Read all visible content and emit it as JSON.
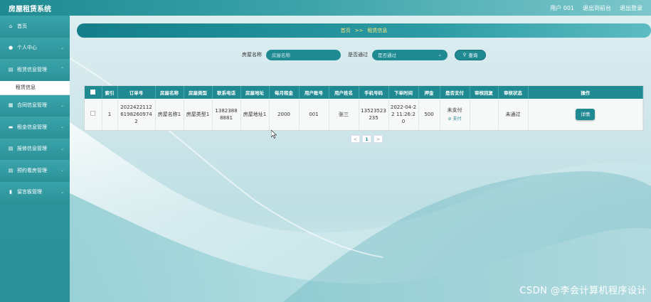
{
  "header": {
    "app_title": "房屋租赁系统",
    "user": "用户 001",
    "back_to_front": "退出到前台",
    "logout": "退出登录"
  },
  "sidebar": {
    "items": [
      {
        "label": "首页",
        "icon": "home-icon"
      },
      {
        "label": "个人中心",
        "icon": "user-icon"
      },
      {
        "label": "租赁信息管理",
        "icon": "doc-icon"
      },
      {
        "label": "合同信息管理",
        "icon": "grid-icon"
      },
      {
        "label": "租金信息管理",
        "icon": "card-icon"
      },
      {
        "label": "报修信息管理",
        "icon": "doc-icon"
      },
      {
        "label": "预约看房管理",
        "icon": "doc-icon"
      },
      {
        "label": "留言板管理",
        "icon": "chart-icon"
      }
    ],
    "submenu": {
      "label": "租赁信息"
    }
  },
  "breadcrumb": {
    "home": "首页",
    "sep": ">>",
    "current": "租赁信息"
  },
  "search": {
    "name_label": "房屋名称",
    "name_placeholder": "房屋名称",
    "passed_label": "是否通过",
    "passed_value": "是否通过",
    "button": "查询"
  },
  "table": {
    "headers": [
      "索引",
      "订单号",
      "房屋名称",
      "房屋类型",
      "联系电话",
      "房屋地址",
      "每月租金",
      "用户账号",
      "用户姓名",
      "手机号码",
      "下单时间",
      "押金",
      "是否支付",
      "审核回复",
      "审核状态",
      "操作"
    ],
    "rows": [
      {
        "index": "1",
        "order_no": "202242211261982609742",
        "house_name": "房屋名称1",
        "house_type": "房屋类型1",
        "phone": "13823888881",
        "address": "房屋地址1",
        "rent": "2000",
        "account": "001",
        "user_name": "张三",
        "mobile": "13523523235",
        "order_time": "2022-04-22 11:26:20",
        "deposit": "500",
        "paid": "未支付",
        "pay_link": "支付",
        "reply": "",
        "status": "未通过",
        "action": "详情"
      }
    ]
  },
  "pagination": {
    "prev": "<",
    "page": "1",
    "next": ">"
  },
  "watermark": "CSDN @李会计算机程序设计"
}
